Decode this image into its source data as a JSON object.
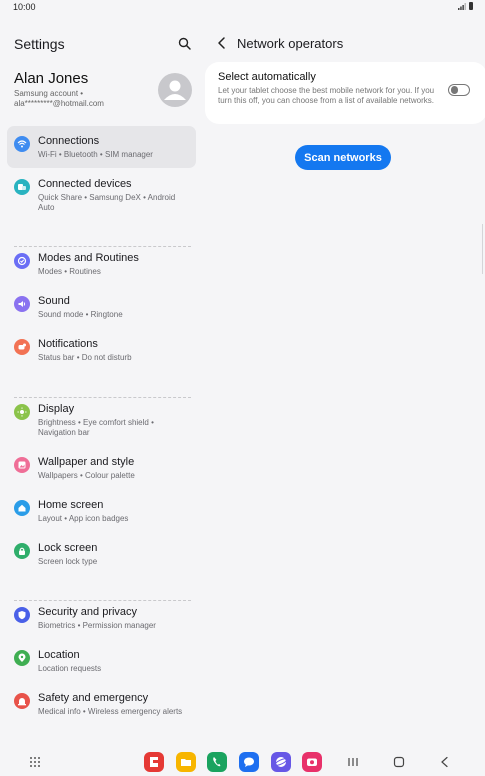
{
  "status": {
    "time": "10:00"
  },
  "settings": {
    "title": "Settings",
    "account": {
      "name": "Alan Jones",
      "line1": "Samsung account  •",
      "line2": "ala*********@hotmail.com"
    },
    "items": [
      {
        "label": "Connections",
        "sub": "Wi-Fi  •  Bluetooth  •  SIM manager",
        "color": "#3f8cf0",
        "icon": "wifi-icon"
      },
      {
        "label": "Connected devices",
        "sub": "Quick Share  •  Samsung DeX  •  Android Auto",
        "color": "#29b3c0",
        "icon": "devices-icon"
      },
      {
        "label": "Modes and Routines",
        "sub": "Modes  •  Routines",
        "color": "#6a6ef5",
        "icon": "check-circle-icon"
      },
      {
        "label": "Sound",
        "sub": "Sound mode  •  Ringtone",
        "color": "#8a72f0",
        "icon": "speaker-icon"
      },
      {
        "label": "Notifications",
        "sub": "Status bar  •  Do not disturb",
        "color": "#f27254",
        "icon": "bell-icon"
      },
      {
        "label": "Display",
        "sub": "Brightness  •  Eye comfort shield  •  Navigation bar",
        "color": "#8bc34a",
        "icon": "sun-icon"
      },
      {
        "label": "Wallpaper and style",
        "sub": "Wallpapers  •  Colour palette",
        "color": "#ef6e97",
        "icon": "image-icon"
      },
      {
        "label": "Home screen",
        "sub": "Layout  •  App icon badges",
        "color": "#2b9de8",
        "icon": "home-icon"
      },
      {
        "label": "Lock screen",
        "sub": "Screen lock type",
        "color": "#2fae6b",
        "icon": "lock-icon"
      },
      {
        "label": "Security and privacy",
        "sub": "Biometrics  •  Permission manager",
        "color": "#4a60e8",
        "icon": "shield-icon"
      },
      {
        "label": "Location",
        "sub": "Location requests",
        "color": "#3fae52",
        "icon": "location-pin-icon"
      },
      {
        "label": "Safety and emergency",
        "sub": "Medical info  •  Wireless emergency alerts",
        "color": "#e8534a",
        "icon": "emergency-icon"
      }
    ]
  },
  "network": {
    "title": "Network operators",
    "auto_title": "Select automatically",
    "auto_desc": "Let your tablet choose the best mobile network for you. If you turn this off, you can choose from a list of available networks.",
    "auto_enabled": false,
    "scan_label": "Scan networks"
  },
  "dock": {
    "apps": [
      {
        "icon": "flipboard-icon",
        "color": "#e53935"
      },
      {
        "icon": "my-files-icon",
        "color": "#f7b500"
      },
      {
        "icon": "phone-icon",
        "color": "#1aa35f"
      },
      {
        "icon": "messages-icon",
        "color": "#1e6ff0"
      },
      {
        "icon": "internet-icon",
        "color": "#6757e6"
      },
      {
        "icon": "camera-icon",
        "color": "#e8316a"
      }
    ]
  }
}
